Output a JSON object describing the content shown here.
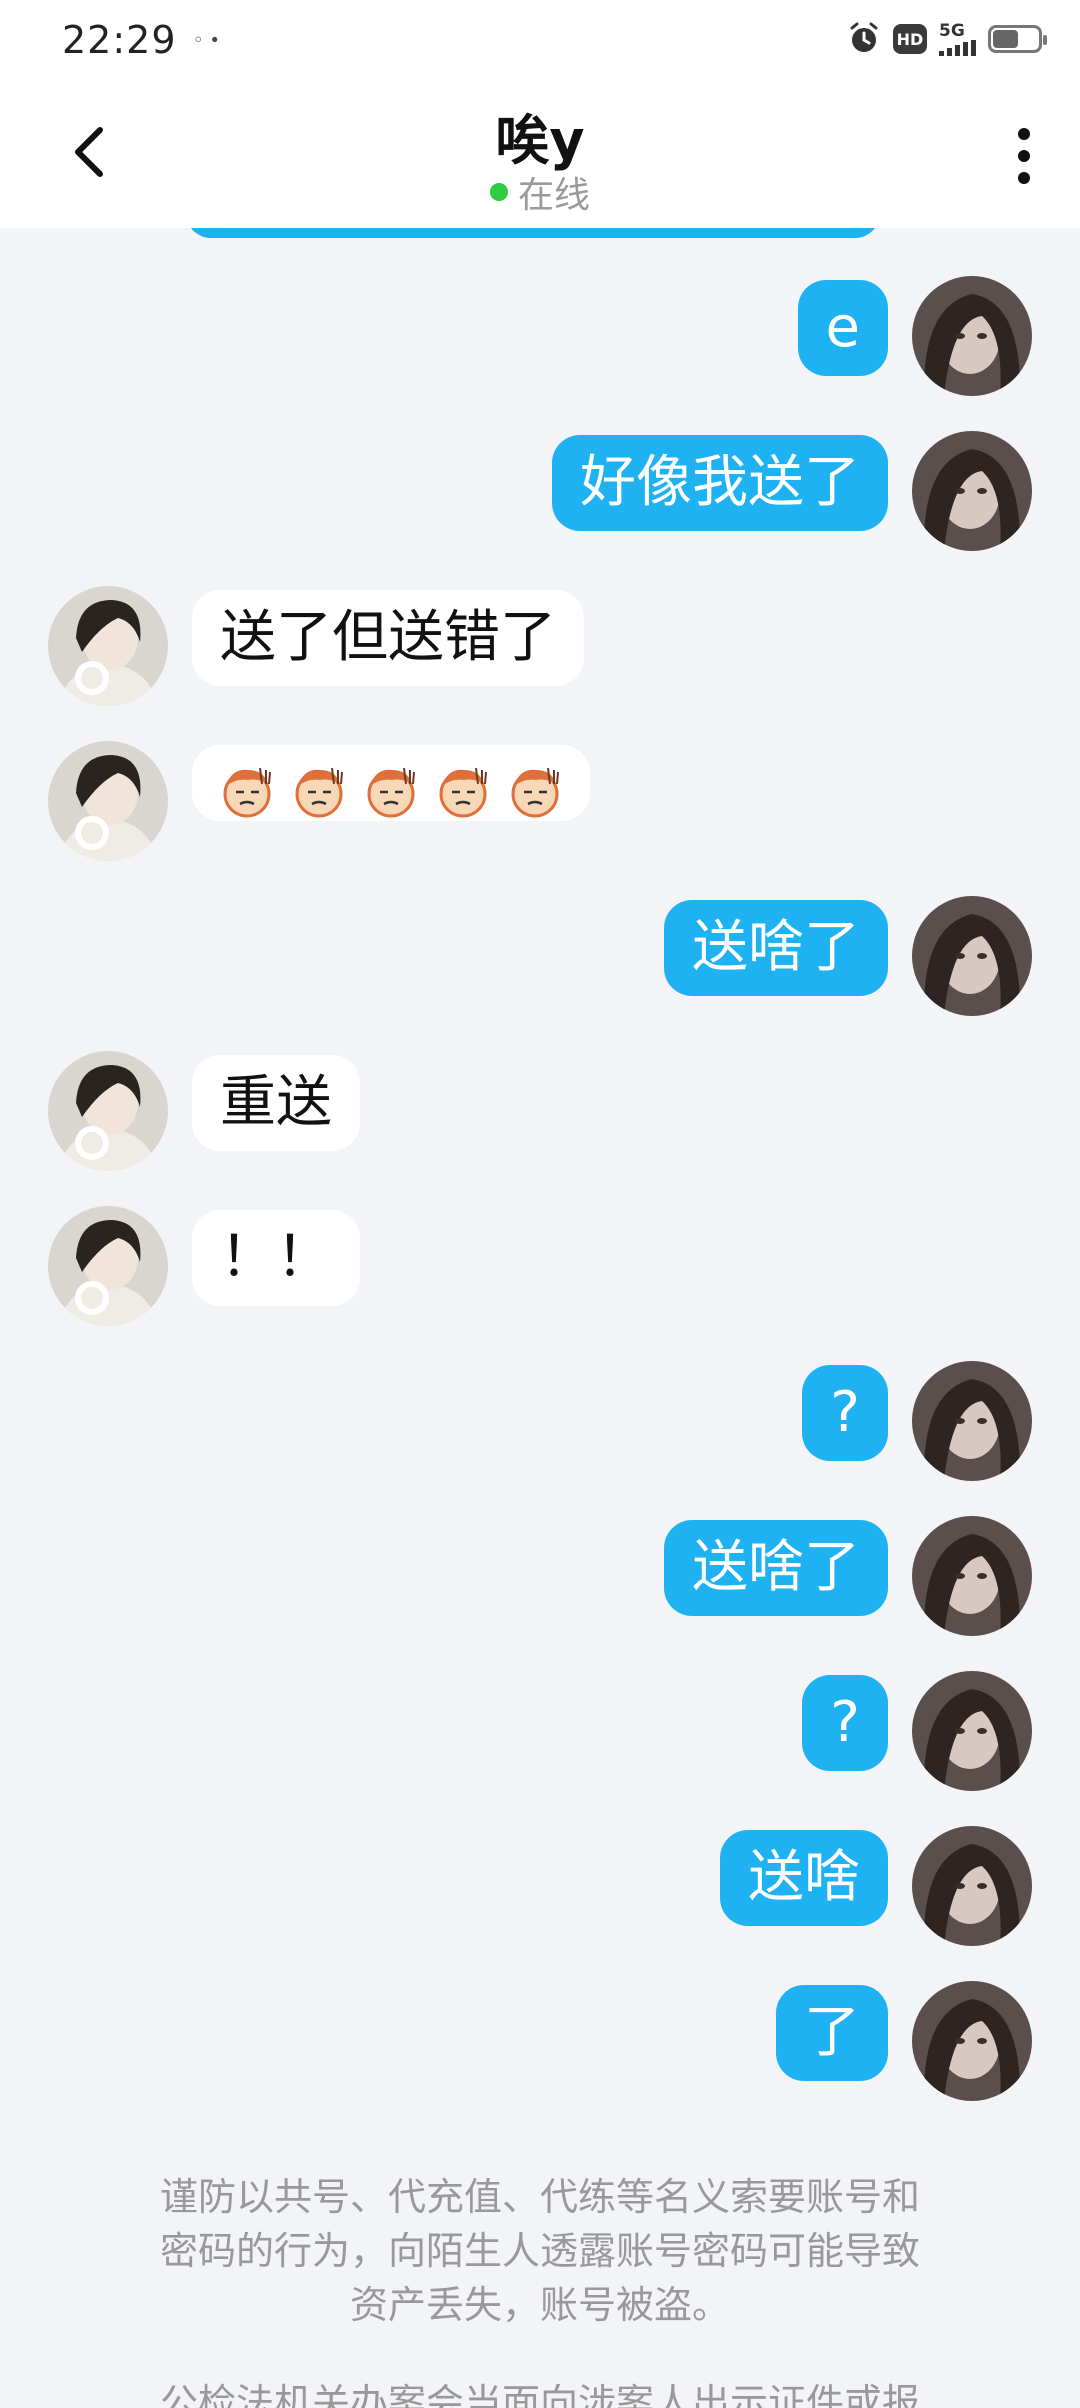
{
  "status_bar": {
    "time": "22:29",
    "indicator": "◦ •",
    "hd": "HD",
    "network": "5G",
    "battery_level": 0.55
  },
  "header": {
    "title": "唉y",
    "status": "在线",
    "status_color": "#2ecc40"
  },
  "colors": {
    "my_bubble": "#1eb2f3",
    "other_bubble": "#ffffff",
    "background": "#f2f4f7"
  },
  "messages": [
    {
      "from": "me",
      "text": "e"
    },
    {
      "from": "me",
      "text": "好像我送了"
    },
    {
      "from": "other",
      "text": "送了但送错了"
    },
    {
      "from": "other",
      "emoji": "grimace-face",
      "count": 5
    },
    {
      "from": "me",
      "text": "送啥了"
    },
    {
      "from": "other",
      "text": "重送"
    },
    {
      "from": "other",
      "text": "！！"
    },
    {
      "from": "me",
      "text": "?"
    },
    {
      "from": "me",
      "text": "送啥了"
    },
    {
      "from": "me",
      "text": "?"
    },
    {
      "from": "me",
      "text": "送啥"
    },
    {
      "from": "me",
      "text": "了"
    }
  ],
  "notice": {
    "line1": "谨防以共号、代充值、代练等名义索要账号和",
    "line2": "密码的行为，向陌生人透露账号密码可能导致",
    "line3": "资产丢失，账号被盗。",
    "line4": "公检法机关办案会当面向涉案人出示证件或报"
  }
}
